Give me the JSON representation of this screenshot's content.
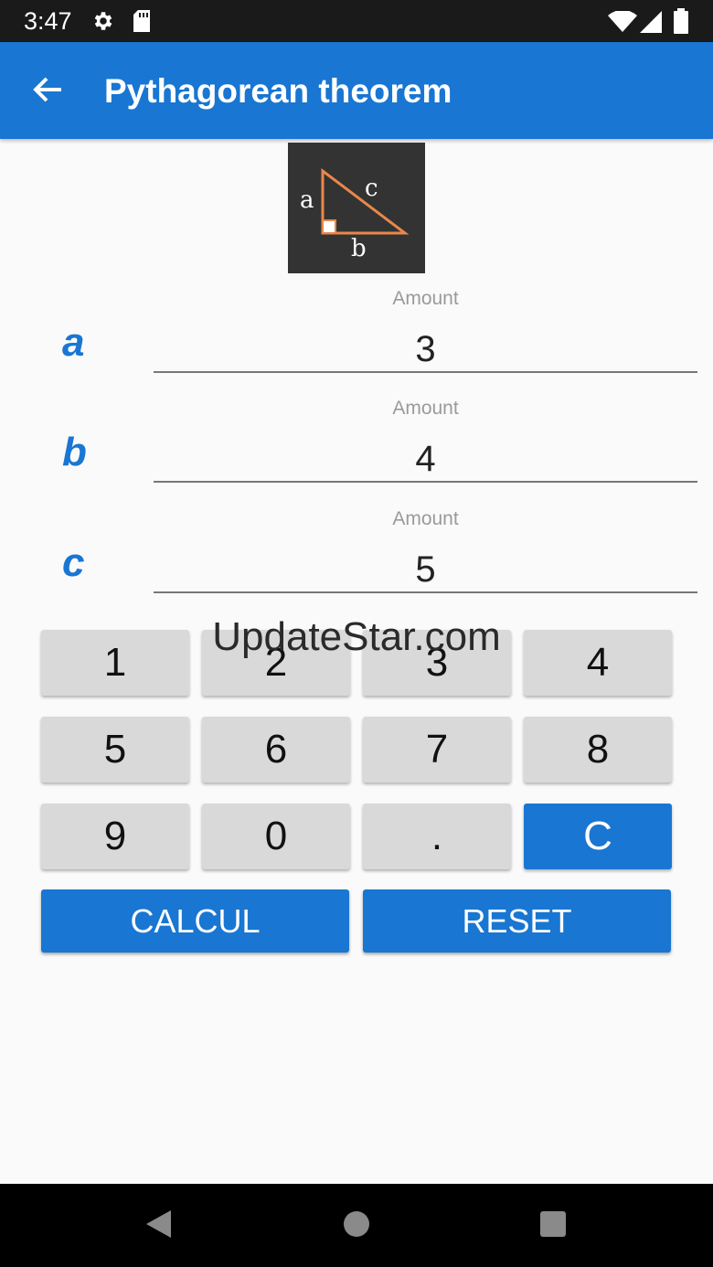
{
  "status_bar": {
    "time": "3:47",
    "icons": [
      "gear-icon",
      "sd-card-icon",
      "wifi-icon",
      "signal-icon",
      "battery-icon"
    ]
  },
  "app_bar": {
    "title": "Pythagorean theorem",
    "back_icon": "arrow-left-icon",
    "color": "#1976d2"
  },
  "diagram": {
    "label_a": "a",
    "label_b": "b",
    "label_c": "c"
  },
  "fields": [
    {
      "label": "a",
      "hint": "Amount",
      "value": "3"
    },
    {
      "label": "b",
      "hint": "Amount",
      "value": "4"
    },
    {
      "label": "c",
      "hint": "Amount",
      "value": "5"
    }
  ],
  "keypad": {
    "keys": [
      "1",
      "2",
      "3",
      "4",
      "5",
      "6",
      "7",
      "8",
      "9",
      "0",
      ".",
      "C"
    ]
  },
  "actions": {
    "calcul_label": "CALCUL",
    "reset_label": "RESET"
  },
  "watermark": "UpdateStar.com",
  "nav_bar": {
    "icons": [
      "back-triangle-icon",
      "home-circle-icon",
      "recents-square-icon"
    ]
  }
}
